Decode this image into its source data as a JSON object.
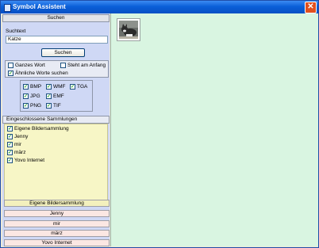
{
  "window": {
    "title": "Symbol Assistent",
    "close_label": "✕"
  },
  "search": {
    "header": "Suchen",
    "label": "Suchtext",
    "value": "Katze",
    "button": "Suchen",
    "options": {
      "whole_word": "Ganzes Wort",
      "starts_with": "Steht am Anfang",
      "similar_words": "Ähnliche Worte suchen"
    },
    "checked": {
      "whole_word": false,
      "starts_with": false,
      "similar_words": true
    }
  },
  "formats": [
    {
      "label": "BMP",
      "checked": true
    },
    {
      "label": "WMF",
      "checked": true
    },
    {
      "label": "TGA",
      "checked": true
    },
    {
      "label": "JPG",
      "checked": true
    },
    {
      "label": "EMF",
      "checked": true
    },
    {
      "label": "PNG",
      "checked": true
    },
    {
      "label": "TIF",
      "checked": true
    }
  ],
  "collections": {
    "header": "Eingeschlossene Sammlungen",
    "items": [
      {
        "label": "Eigene Bildersammlung",
        "checked": true
      },
      {
        "label": "Jenny",
        "checked": true
      },
      {
        "label": "mir",
        "checked": true
      },
      {
        "label": "märz",
        "checked": true
      },
      {
        "label": "Yovo Internet",
        "checked": true
      }
    ]
  },
  "collection_buttons": [
    "Eigene Bildersammlung",
    "Jenny",
    "mir",
    "märz",
    "Yovo Internet"
  ],
  "results": [
    {
      "icon": "cat-photo-thumbnail"
    }
  ],
  "colors": {
    "titlebar": "#0a5fd8",
    "left_panel": "#cfd8f5",
    "results_bg": "#d9f5e1",
    "collections_bg": "#f7f6c6",
    "collection_button": "#fbe7e3"
  }
}
